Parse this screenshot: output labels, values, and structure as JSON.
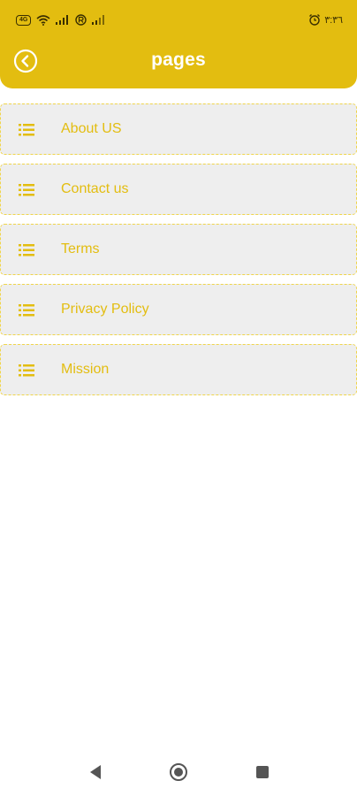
{
  "status_bar": {
    "network_badge": "4G",
    "time": "٣:٣٦"
  },
  "header": {
    "title": "pages"
  },
  "menu": {
    "items": [
      {
        "label": "About US"
      },
      {
        "label": "Contact us"
      },
      {
        "label": "Terms"
      },
      {
        "label": "Privacy Policy"
      },
      {
        "label": "Mission"
      }
    ]
  },
  "colors": {
    "accent": "#e3bd10",
    "item_background": "#eeeeee",
    "item_border": "#f0d54a"
  },
  "icons": {
    "back": "back-arrow-circle-icon",
    "list_item": "list-icon",
    "nav_back": "triangle-back-icon",
    "nav_home": "circle-home-icon",
    "nav_recents": "square-recents-icon"
  }
}
